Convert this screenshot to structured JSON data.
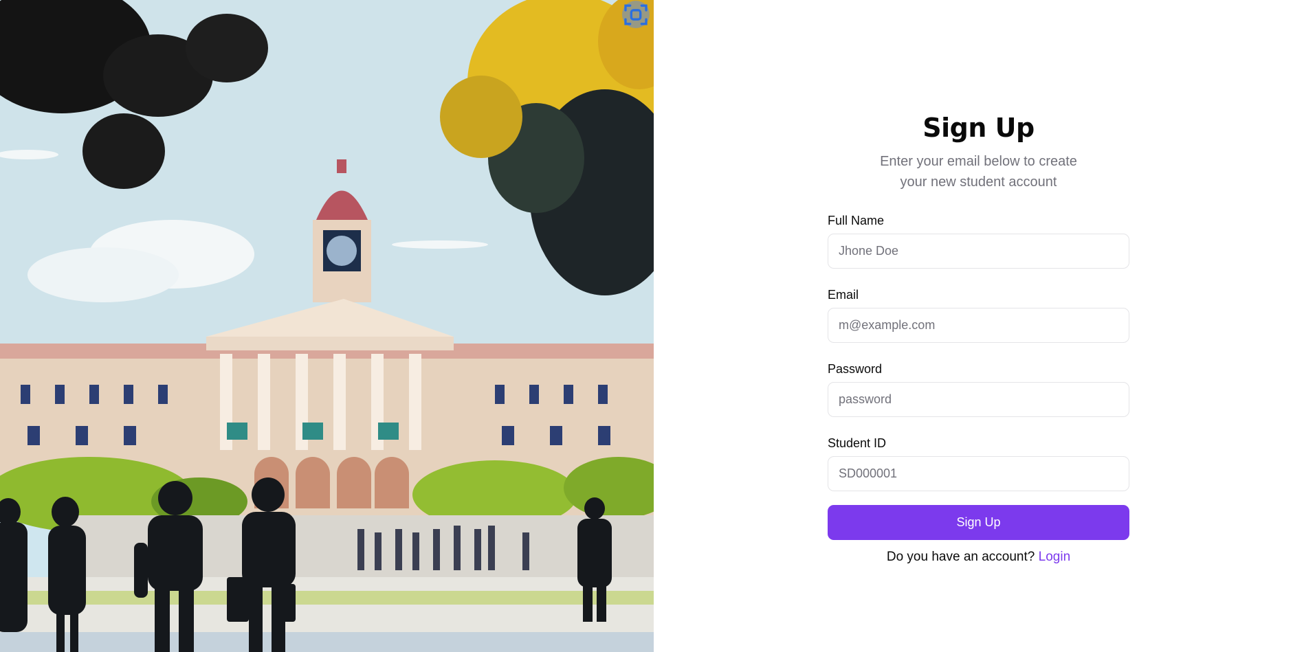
{
  "hero": {
    "scan_icon": "scan-focus-icon"
  },
  "form": {
    "title": "Sign Up",
    "subtitle": "Enter your email below to create your new student account",
    "fields": [
      {
        "label": "Full Name",
        "placeholder": "Jhone Doe",
        "value": ""
      },
      {
        "label": "Email",
        "placeholder": "m@example.com",
        "value": ""
      },
      {
        "label": "Password",
        "placeholder": "password",
        "value": ""
      },
      {
        "label": "Student ID",
        "placeholder": "SD000001",
        "value": ""
      }
    ],
    "submit_label": "Sign Up"
  },
  "footer": {
    "prompt": "Do you have an account?",
    "login_label": "Login"
  },
  "colors": {
    "accent": "#7c3aed",
    "muted_text": "#71717a",
    "input_border": "#e4e4e7"
  }
}
